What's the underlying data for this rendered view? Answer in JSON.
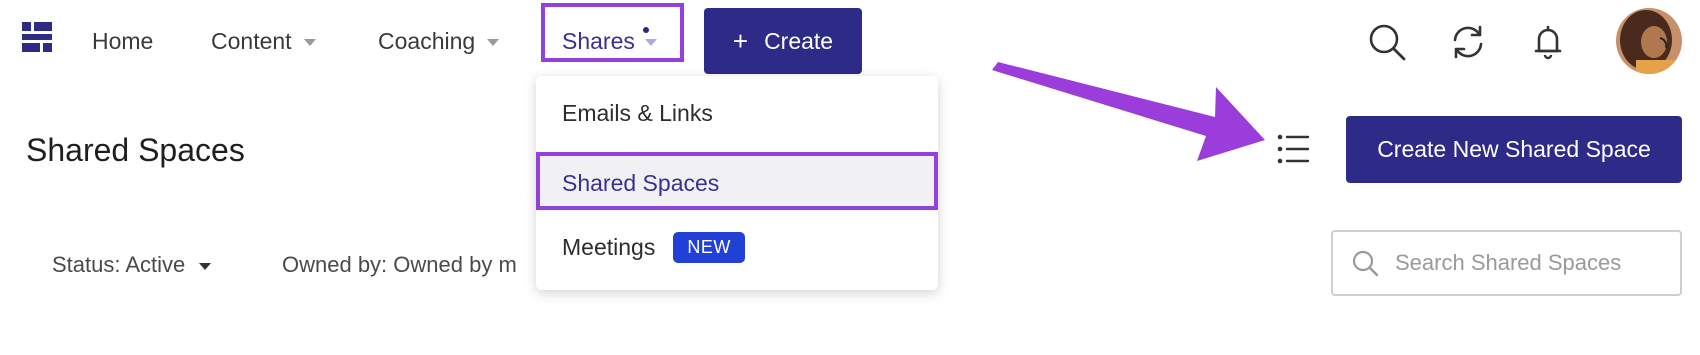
{
  "nav": {
    "home": "Home",
    "content": "Content",
    "coaching": "Coaching",
    "shares": "Shares",
    "create": "Create"
  },
  "header_icons": [
    "search-icon",
    "sync-icon",
    "bell-icon"
  ],
  "dropdown": {
    "items": [
      {
        "label": "Emails & Links"
      },
      {
        "label": "Shared Spaces",
        "selected": true
      },
      {
        "label": "Meetings",
        "badge": "NEW"
      }
    ]
  },
  "page": {
    "title": "Shared Spaces",
    "new_button": "Create New Shared Space"
  },
  "filters": {
    "status": "Status: Active",
    "owned_by": "Owned by: Owned by m"
  },
  "search": {
    "placeholder": "Search Shared Spaces"
  },
  "colors": {
    "brand": "#2e2a88",
    "highlight": "#9440dd",
    "badge": "#2140d6"
  }
}
